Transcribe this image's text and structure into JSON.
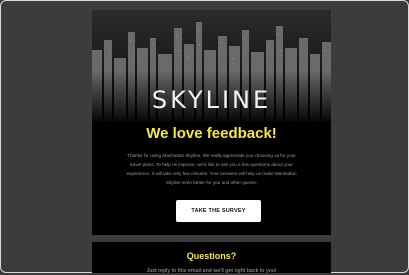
{
  "email": {
    "logo_text": "SKYLINE",
    "headline": "We love feedback!",
    "body_lines": [
      "Thanks for using Manhattan Skyline. We really appreciate you choosing us for your",
      "travel plans. To help us improve, we'd like to ask you a few questions about your",
      "experience. It will take only few minutes. Your answers will help us make Manhattan",
      "Skyline even better for you and other guests."
    ],
    "cta_label": "TAKE THE SURVEY",
    "footer_title": "Questions?",
    "footer_text": "Just reply to this email and we'll get right back to you!"
  },
  "colors": {
    "accent_yellow": "#f4e93c",
    "background": "#3c3c3c",
    "email_bg": "#000000"
  }
}
